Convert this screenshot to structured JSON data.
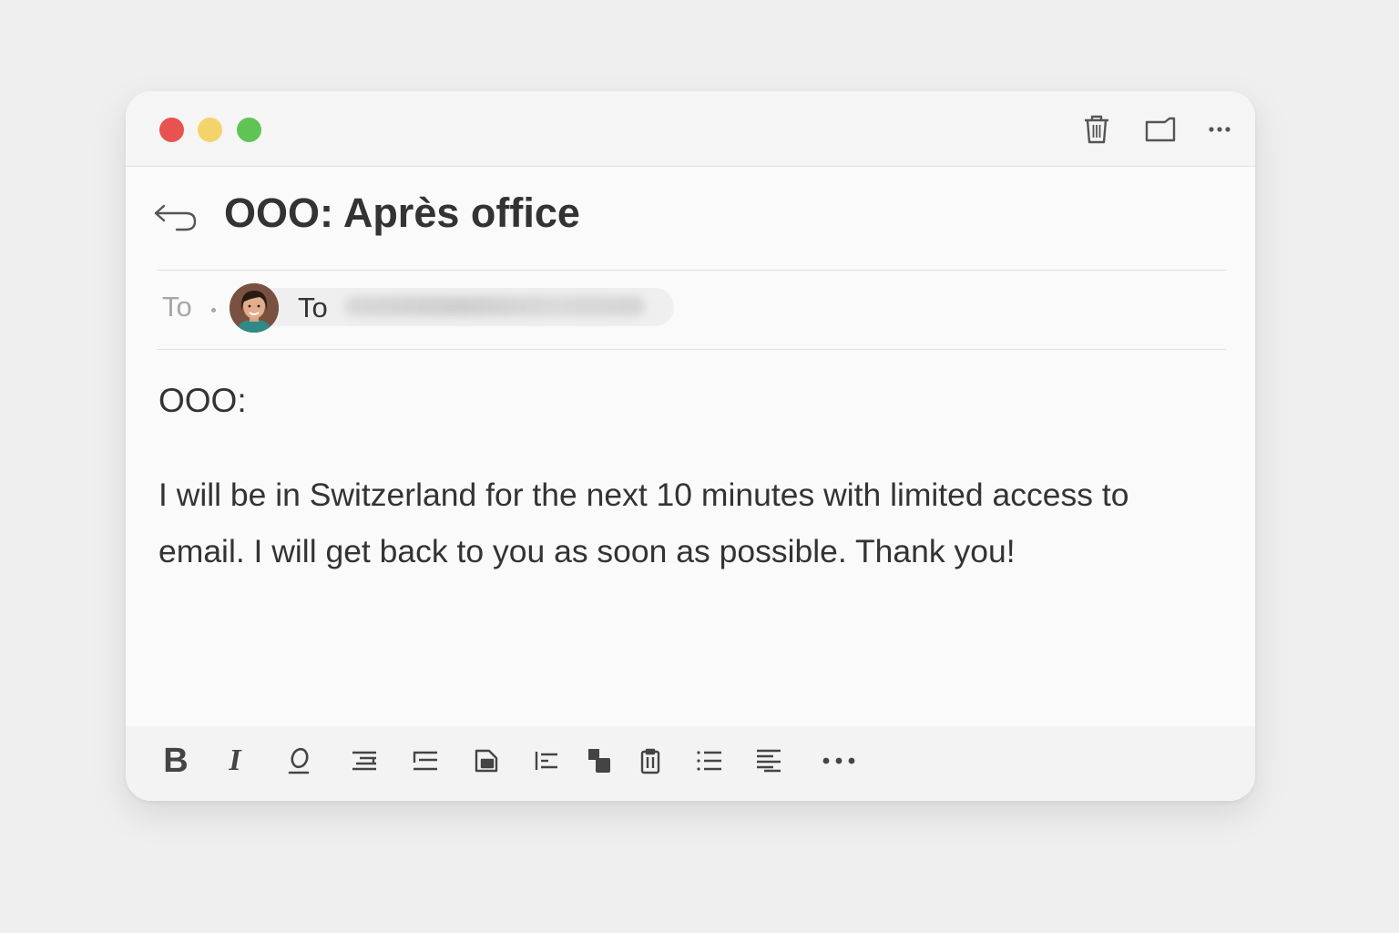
{
  "window": {
    "controls": [
      "close",
      "minimize",
      "zoom"
    ],
    "toolbar_icons": [
      "trash-icon",
      "folder-icon",
      "more-icon"
    ]
  },
  "email": {
    "subject": "OOO: Après office",
    "to_label": "To",
    "recipient_chip_label": "To",
    "greeting": "OOO:",
    "body": "I will be in Switzerland for the next 10 minutes with limited access to email. I will get back to you as soon as possible. Thank you!"
  },
  "format_toolbar": {
    "bold": "B",
    "italic": "I",
    "underline": "O",
    "items": [
      "bold-icon",
      "italic-icon",
      "underline-icon",
      "align-icon",
      "text-block-icon",
      "image-icon",
      "indent-icon",
      "shape-icon",
      "clipboard-icon",
      "bullet-list-icon",
      "justify-icon",
      "more-options-icon"
    ]
  },
  "colors": {
    "close": "#e8534f",
    "minimize": "#f5d36b",
    "zoom": "#5fc454",
    "text": "#333333",
    "muted": "#a6a6a6"
  }
}
